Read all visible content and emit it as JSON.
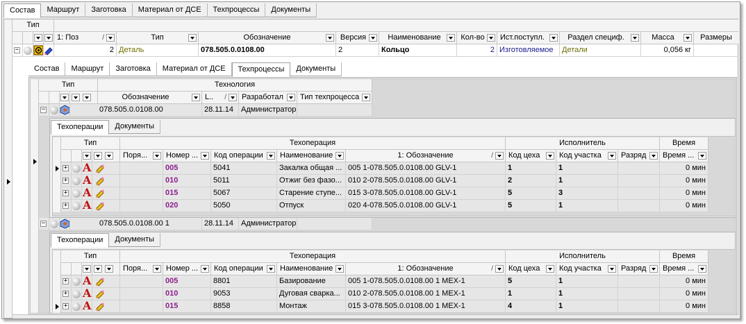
{
  "outer_tabs": [
    "Состав",
    "Маршрут",
    "Заготовка",
    "Материал от ДСЕ",
    "Техпроцессы",
    "Документы"
  ],
  "outer_header": {
    "group_type": "Тип",
    "columns": [
      "1: Поз",
      "Тип",
      "Обозначение",
      "Версия",
      "Наименование",
      "Кол-во",
      "Ист.поступл.",
      "Раздел специф.",
      "Масса",
      "Размеры"
    ]
  },
  "outer_row": {
    "pos": "2",
    "type": "Деталь",
    "designation": "078.505.0.0108.00",
    "version": "2",
    "name": "Кольцо",
    "qty": "2",
    "source": "Изготовляемое",
    "section": "Детали",
    "mass": "0,056 кг",
    "size": ""
  },
  "inner_tabs": [
    "Состав",
    "Маршрут",
    "Заготовка",
    "Материал от ДСЕ",
    "Техпроцессы",
    "Документы"
  ],
  "tp_header": {
    "group_type": "Тип",
    "group_tech": "Технология",
    "columns": [
      "Обозначение",
      "L..",
      "Разработал",
      "Тип техпроцесса"
    ]
  },
  "tp_rows": [
    {
      "designation": "078.505.0.0108.00",
      "date": "28.11.14",
      "author": "Администратор"
    },
    {
      "designation": "078.505.0.0108.00 1",
      "date": "28.11.14",
      "author": "Администратор"
    }
  ],
  "op_tabs": [
    "Техоперации",
    "Документы"
  ],
  "op_header": {
    "group_type": "Тип",
    "group_op": "Техоперация",
    "group_exec": "Исполнитель",
    "group_time": "Время",
    "columns": [
      "Поря...",
      "Номер ...",
      "Код операции",
      "Наименование",
      "1: Обозначение",
      "Код цеха",
      "Код участка",
      "Разряд",
      "Время ..."
    ]
  },
  "op_tables": [
    [
      {
        "num": "005",
        "code": "5041",
        "name": "Закалка общая ...",
        "desig": "005 1-078.505.0.0108.00 GLV-1",
        "shop": "1",
        "area": "1",
        "grade": "",
        "time": "0 мин"
      },
      {
        "num": "010",
        "code": "5011",
        "name": "Отжиг без фазо...",
        "desig": "010 2-078.505.0.0108.00 GLV-1",
        "shop": "2",
        "area": "1",
        "grade": "",
        "time": "0 мин"
      },
      {
        "num": "015",
        "code": "5067",
        "name": "Старение ступе...",
        "desig": "015 3-078.505.0.0108.00 GLV-1",
        "shop": "5",
        "area": "3",
        "grade": "",
        "time": "0 мин"
      },
      {
        "num": "020",
        "code": "5050",
        "name": "Отпуск",
        "desig": "020 4-078.505.0.0108.00 GLV-1",
        "shop": "5",
        "area": "1",
        "grade": "",
        "time": "0 мин"
      }
    ],
    [
      {
        "num": "005",
        "code": "8801",
        "name": "Базирование",
        "desig": "005 1-078.505.0.0108.00 1 MEX-1",
        "shop": "5",
        "area": "1",
        "grade": "",
        "time": "0 мин"
      },
      {
        "num": "010",
        "code": "9053",
        "name": "Дуговая сварка...",
        "desig": "010 2-078.505.0.0108.00 1 MEX-1",
        "shop": "1",
        "area": "1",
        "grade": "",
        "time": "0 мин"
      },
      {
        "num": "015",
        "code": "8858",
        "name": "Монтаж",
        "desig": "015 3-078.505.0.0108.00 1 MEX-1",
        "shop": "4",
        "area": "1",
        "grade": "",
        "time": "0 мин"
      }
    ]
  ]
}
